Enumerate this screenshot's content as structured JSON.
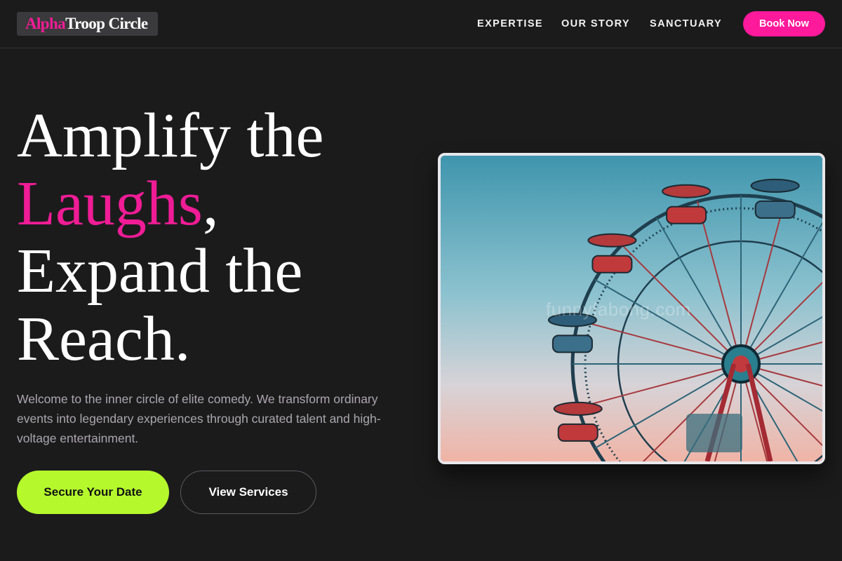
{
  "header": {
    "logo": {
      "part1": "Alpha",
      "part2": "Troop Circle"
    },
    "nav": [
      "EXPERTISE",
      "OUR STORY",
      "SANCTUARY"
    ],
    "book_label": "Book Now"
  },
  "hero": {
    "line1": "Amplify the",
    "highlight": "Laughs",
    "comma": ",",
    "line3": "Expand the",
    "line4": "Reach.",
    "description": "Welcome to the inner circle of elite comedy. We transform ordinary events into legendary experiences through curated talent and high-voltage entertainment.",
    "primary_cta": "Secure Your Date",
    "secondary_cta": "View Services"
  },
  "image": {
    "watermark": "funnyfabong.com"
  },
  "colors": {
    "background": "#1c1b1c",
    "accent_pink": "#ff199b",
    "accent_lime": "#b5f92d"
  }
}
